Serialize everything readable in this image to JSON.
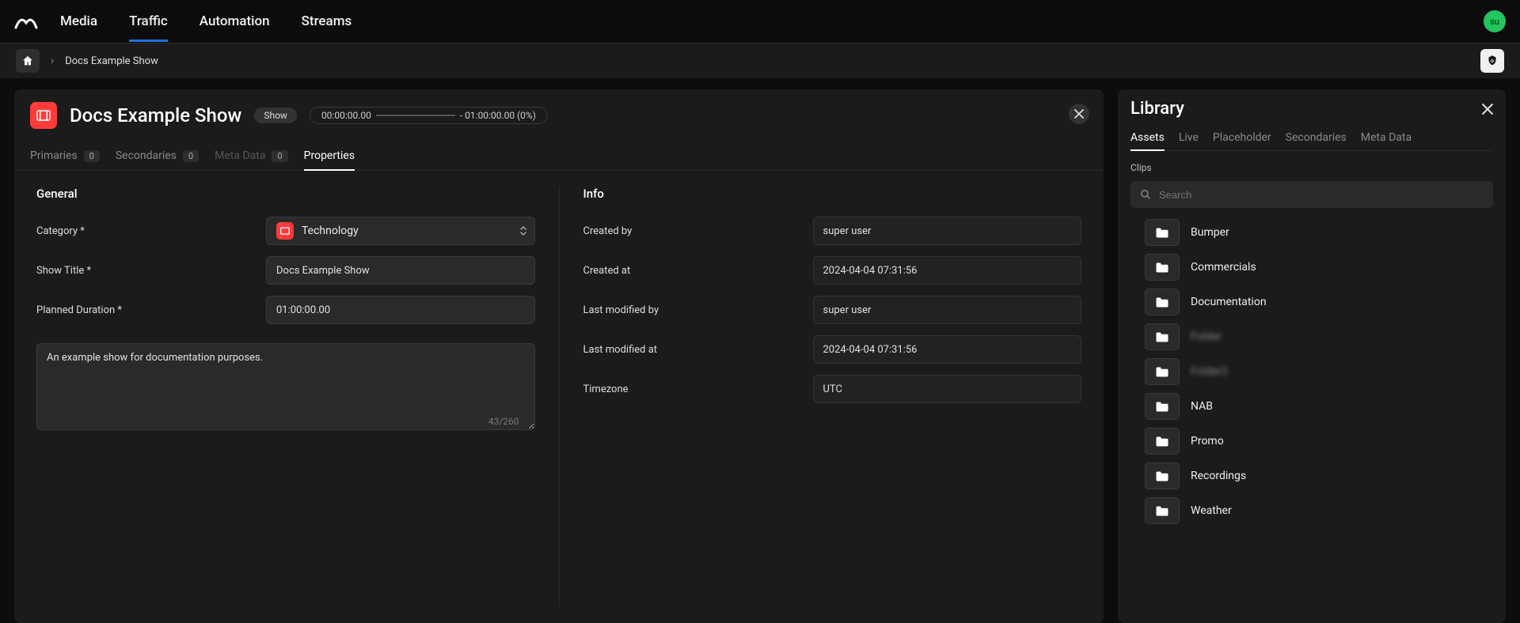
{
  "nav": {
    "tabs": [
      "Media",
      "Traffic",
      "Automation",
      "Streams"
    ],
    "active": "Traffic",
    "user_initials": "su"
  },
  "breadcrumb": {
    "item": "Docs Example Show"
  },
  "editor": {
    "title": "Docs Example Show",
    "badge": "Show",
    "time_start": "00:00:00.00",
    "time_end": "- 01:00:00.00 (0%)",
    "tabs": {
      "primaries": {
        "label": "Primaries",
        "count": "0"
      },
      "secondaries": {
        "label": "Secondaries",
        "count": "0"
      },
      "metadata": {
        "label": "Meta Data",
        "count": "0"
      },
      "properties": {
        "label": "Properties"
      }
    },
    "general": {
      "heading": "General",
      "category_label": "Category *",
      "category_value": "Technology",
      "show_title_label": "Show Title *",
      "show_title_value": "Docs Example Show",
      "planned_duration_label": "Planned Duration *",
      "planned_duration_value": "01:00:00.00",
      "description_value": "An example show for documentation purposes.",
      "char_count": "43/260"
    },
    "info": {
      "heading": "Info",
      "created_by_label": "Created by",
      "created_by_value": "super user",
      "created_at_label": "Created at",
      "created_at_value": "2024-04-04 07:31:56",
      "modified_by_label": "Last modified by",
      "modified_by_value": "super user",
      "modified_at_label": "Last modified at",
      "modified_at_value": "2024-04-04 07:31:56",
      "timezone_label": "Timezone",
      "timezone_value": "UTC"
    }
  },
  "library": {
    "title": "Library",
    "tabs": [
      "Assets",
      "Live",
      "Placeholder",
      "Secondaries",
      "Meta Data"
    ],
    "active": "Assets",
    "section_label": "Clips",
    "search_placeholder": "Search",
    "folders": [
      {
        "name": "Bumper"
      },
      {
        "name": "Commercials"
      },
      {
        "name": "Documentation"
      },
      {
        "name": "Folder",
        "blurred": true
      },
      {
        "name": "Folder2",
        "blurred": true
      },
      {
        "name": "NAB"
      },
      {
        "name": "Promo"
      },
      {
        "name": "Recordings"
      },
      {
        "name": "Weather"
      }
    ]
  }
}
